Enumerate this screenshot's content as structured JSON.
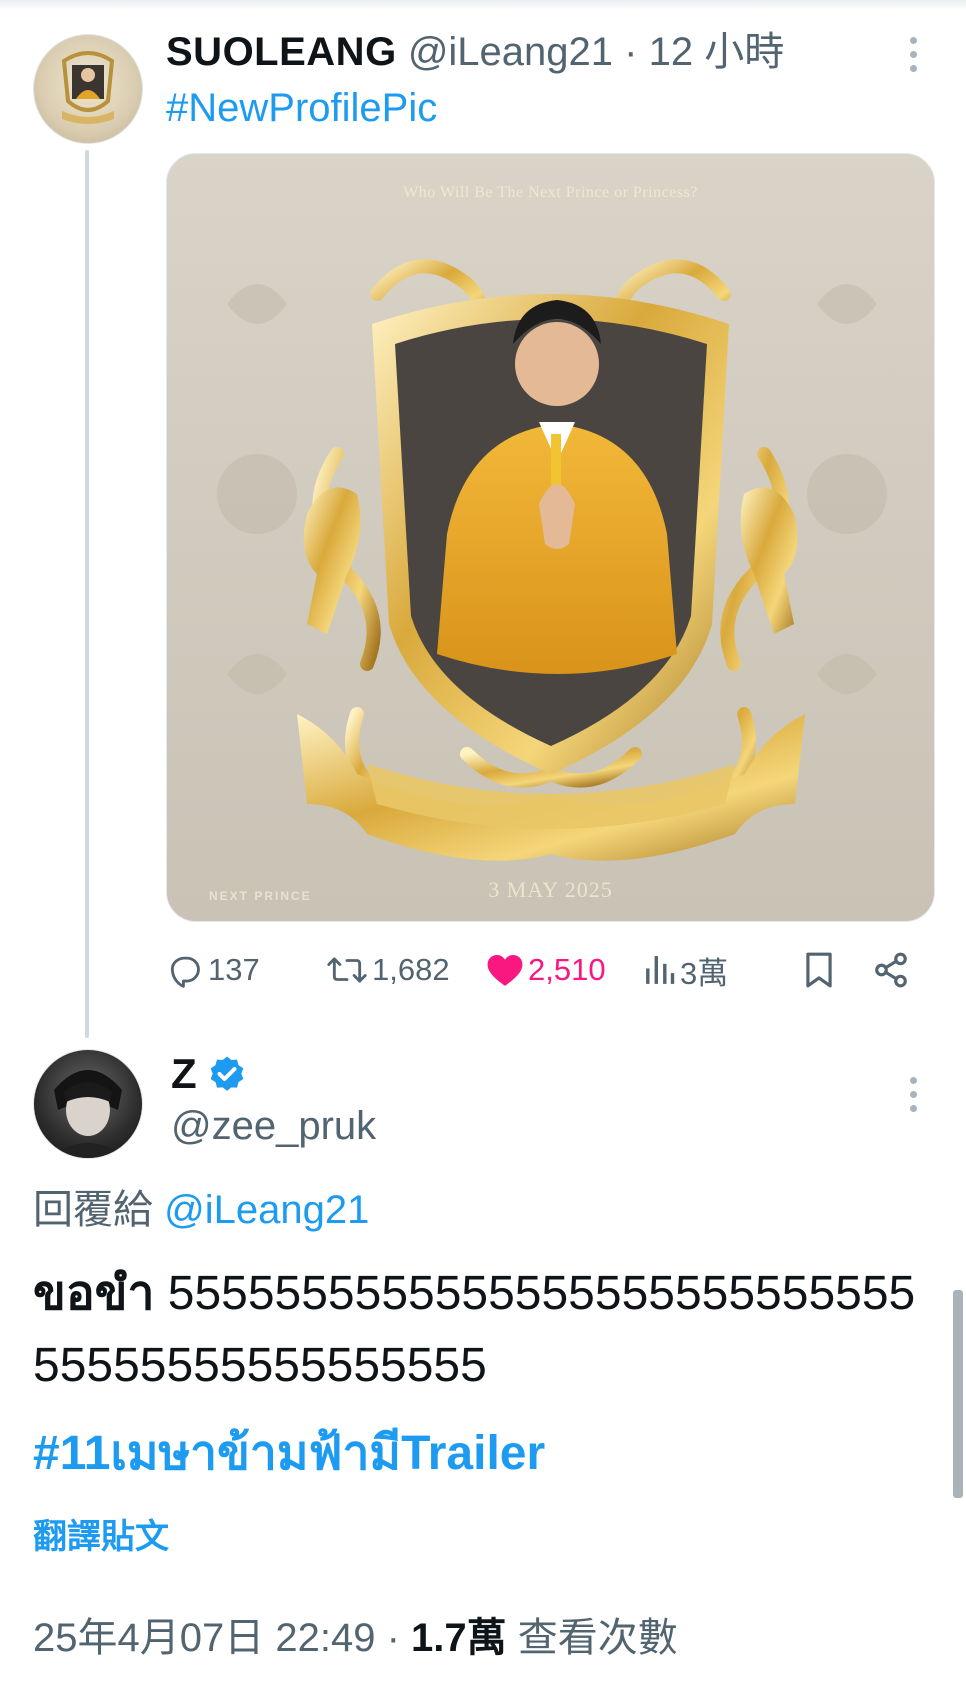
{
  "tweet1": {
    "display_name": "SUOLEANG",
    "handle": "@iLeang21",
    "separator": "·",
    "time": "12 小時",
    "text": "#NewProfilePic",
    "media": {
      "caption_top": "Who Will Be The Next Prince or Princess?",
      "caption_left": "NEXT PRINCE",
      "caption_date": "3 MAY 2025"
    },
    "actions": {
      "replies": "137",
      "reposts": "1,682",
      "likes": "2,510",
      "views": "3萬"
    }
  },
  "tweet2": {
    "display_name": "Z",
    "handle": "@zee_pruk",
    "reply_prefix": "回覆給",
    "reply_handle": "@iLeang21",
    "text_thai": "ขอขำ",
    "text_numbers": "555555555555555555555555555555555555555555555",
    "hashtag": "#11เมษาข้ามฟ้ามีTrailer",
    "translate_label": "翻譯貼文",
    "date": "25年4月07日 22:49",
    "separator": "·",
    "views_count": "1.7萬",
    "views_label": "查看次數"
  },
  "colors": {
    "accent": "#1d9bf0",
    "like": "#f91880",
    "muted": "#536471",
    "text": "#0f1419"
  },
  "icons": [
    "more-icon",
    "reply-icon",
    "repost-icon",
    "like-icon",
    "views-icon",
    "bookmark-icon",
    "share-icon",
    "verified-icon"
  ]
}
